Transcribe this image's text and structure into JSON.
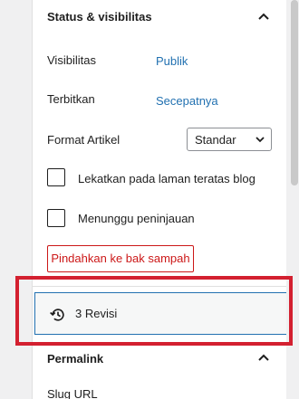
{
  "status_section": {
    "title": "Status & visibilitas",
    "visibility_label": "Visibilitas",
    "visibility_value": "Publik",
    "publish_label": "Terbitkan",
    "publish_value": "Secepatnya",
    "format_label": "Format Artikel",
    "format_selected": "Standar",
    "sticky_label": "Lekatkan pada laman teratas blog",
    "sticky_checked": false,
    "pending_label": "Menunggu peninjauan",
    "pending_checked": false,
    "trash_label": "Pindahkan ke bak sampah",
    "revisions_label": "3 Revisi"
  },
  "permalink_section": {
    "title": "Permalink",
    "slug_label": "Slug URL"
  },
  "colors": {
    "link": "#2271b1",
    "danger": "#cc1818",
    "highlight": "#d32030"
  },
  "icons": [
    "chevron-up-icon",
    "chevron-down-icon",
    "history-icon"
  ]
}
